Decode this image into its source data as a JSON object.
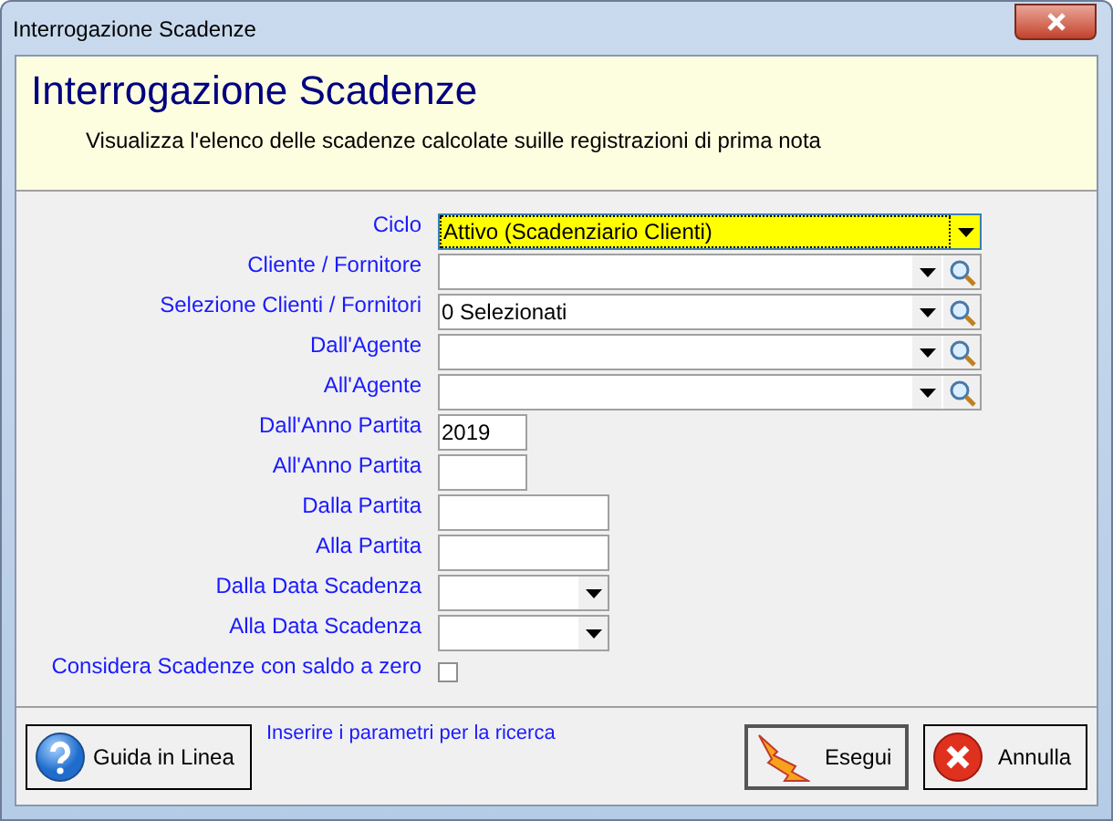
{
  "window": {
    "title": "Interrogazione Scadenze"
  },
  "header": {
    "title": "Interrogazione Scadenze",
    "subtitle": "Visualizza l'elenco delle scadenze calcolate suille registrazioni di prima nota"
  },
  "fields": [
    {
      "label": "Ciclo",
      "kind": "select",
      "value": "Attivo (Scadenziario Clienti)",
      "focused": true
    },
    {
      "label": "Cliente / Fornitore",
      "kind": "lookup",
      "focused": false
    },
    {
      "label": "Selezione Clienti / Fornitori",
      "kind": "lookup",
      "value": "0 Selezionati",
      "focused": false
    },
    {
      "label": "Dall'Agente",
      "kind": "lookup",
      "focused": false
    },
    {
      "label": "All'Agente",
      "kind": "lookup",
      "focused": false
    },
    {
      "label": "Dall'Anno Partita",
      "kind": "year",
      "value": "2019",
      "focused": false
    },
    {
      "label": "All'Anno Partita",
      "kind": "year",
      "focused": false
    },
    {
      "label": "Dalla Partita",
      "kind": "text",
      "focused": false
    },
    {
      "label": "Alla Partita",
      "kind": "text",
      "focused": false
    },
    {
      "label": "Dalla Data Scadenza",
      "kind": "date",
      "focused": false
    },
    {
      "label": "Alla Data Scadenza",
      "kind": "date",
      "focused": false
    },
    {
      "label": "Considera Scadenze con saldo a zero",
      "kind": "checkbox",
      "checked": false
    }
  ],
  "footer": {
    "help_button": "Guida in Linea",
    "hint": "Inserire i parametri per la ricerca",
    "run_button": "Esegui",
    "cancel_button": "Annulla"
  }
}
